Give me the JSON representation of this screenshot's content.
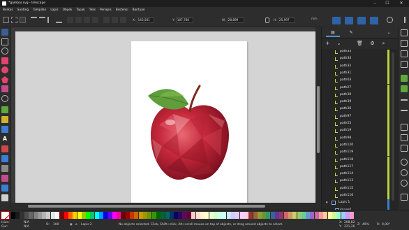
{
  "window": {
    "title": "*gambar.svg - Inkscape",
    "minimize": "–",
    "maximize": "☐",
    "close": "✕"
  },
  "menu": [
    "Berkas",
    "Sunting",
    "Tampilan",
    "Lapis",
    "Obyek",
    "Tapak",
    "Teks",
    "Penapis",
    "Ekstensi",
    "Bantuan"
  ],
  "toolbar": {
    "x_label": "X:",
    "x_value": "143,501",
    "y_label": "Y:",
    "y_value": "187,786",
    "w_label": "W:",
    "w_value": "28,899",
    "h_label": "H:",
    "h_value": "25,997",
    "unit": "mm"
  },
  "dock": {
    "tabs": [
      "Layers",
      "Objects"
    ],
    "items": [
      {
        "label": "path33",
        "kind": "path"
      },
      {
        "label": "path34",
        "kind": "path"
      },
      {
        "label": "path32",
        "kind": "path"
      },
      {
        "label": "path31",
        "kind": "path"
      },
      {
        "label": "path03",
        "kind": "path"
      },
      {
        "label": "path27",
        "kind": "path"
      },
      {
        "label": "path30",
        "kind": "path"
      },
      {
        "label": "path39",
        "kind": "path"
      },
      {
        "label": "path36",
        "kind": "path"
      },
      {
        "label": "path97",
        "kind": "path"
      },
      {
        "label": "path55",
        "kind": "path"
      },
      {
        "label": "path19",
        "kind": "path"
      },
      {
        "label": "path98",
        "kind": "path"
      },
      {
        "label": "path120",
        "kind": "path"
      },
      {
        "label": "path119",
        "kind": "path"
      },
      {
        "label": "path118",
        "kind": "path"
      },
      {
        "label": "path117",
        "kind": "path"
      },
      {
        "label": "path114",
        "kind": "path"
      },
      {
        "label": "path113",
        "kind": "path"
      },
      {
        "label": "path115",
        "kind": "path"
      },
      {
        "label": "path116",
        "kind": "path"
      },
      {
        "label": "Lapis 1",
        "kind": "layer"
      },
      {
        "label": "image1",
        "kind": "image"
      }
    ]
  },
  "status": {
    "fill_label": "Isian:",
    "fill_value": "N/A",
    "stroke_label": "Gur:",
    "stroke_value": "N/A",
    "opacity_label": "O:",
    "opacity_value": "100",
    "layer": "Lapis 2",
    "message": "No objects selected. Click, Shift+click, Alt+scroll mouse on top of objects, or drag around objects to select.",
    "x_label": "X:",
    "x_value": "208,82",
    "y_label": "Y:",
    "y_value": "221,26",
    "z_label": "Z:",
    "zoom": "49%",
    "r_label": "R:",
    "rotation": "0,00°"
  },
  "colors": {
    "accent": "#4b8fd6",
    "layer_bar": "#b8d53a",
    "canvas_bg": "#d4d4d4"
  }
}
